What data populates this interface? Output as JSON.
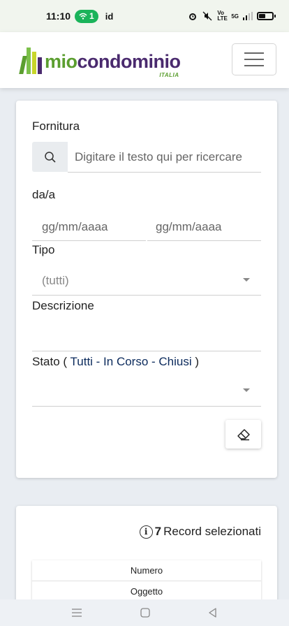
{
  "status_bar": {
    "time": "11:10",
    "wifi_badge": "1",
    "extra": "id",
    "network": "Vo LTE",
    "signal": "5G"
  },
  "navbar": {
    "logo_mio": "mio",
    "logo_condominio": "condominio",
    "logo_italia": "ITALIA"
  },
  "filter": {
    "fornitura_label": "Fornitura",
    "search_placeholder": "Digitare il testo qui per ricercare",
    "daa_label": "da/a",
    "date_from_placeholder": "gg/mm/aaaa",
    "date_to_placeholder": "gg/mm/aaaa",
    "tipo_label": "Tipo",
    "tipo_value": "(tutti)",
    "descrizione_label": "Descrizione",
    "stato_prefix": "Stato (",
    "stato_options": "Tutti - In Corso - Chiusi",
    "stato_suffix": ")",
    "stato_value": ""
  },
  "results": {
    "record_count": "7",
    "record_text": "Record selezionati",
    "columns": [
      "Numero",
      "Oggetto"
    ]
  },
  "colors": {
    "brand_green": "#5b9e2f",
    "brand_purple": "#4a2a6e",
    "wifi_green": "#1ab35a"
  }
}
